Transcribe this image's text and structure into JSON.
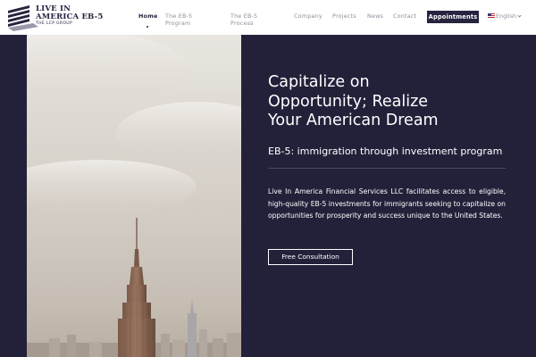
{
  "brand": {
    "line1": "LIVE IN",
    "line2": "AMERICA EB-5",
    "line3": "THE LCP GROUP"
  },
  "nav": {
    "home": "Home",
    "program_line1": "The EB-5",
    "program_line2": "Program",
    "process_line1": "The EB-5",
    "process_line2": "Process",
    "company": "Company",
    "projects": "Projects",
    "news": "News",
    "contact": "Contact",
    "appointments": "Appointments",
    "language": "English"
  },
  "hero": {
    "headline_line1": "Capitalize on",
    "headline_line2": "Opportunity; Realize",
    "headline_line3": "Your American Dream",
    "subheading": "EB-5: immigration through investment program",
    "body": "Live In America Financial Services LLC facilitates access to eligible, high-quality EB-5 investments for immigrants seeking to capitalize on opportunities for prosperity and success unique to the United States.",
    "cta_label": "Free Consultation"
  },
  "colors": {
    "navy": "#23213a",
    "brand": "#26243f",
    "white": "#ffffff"
  }
}
